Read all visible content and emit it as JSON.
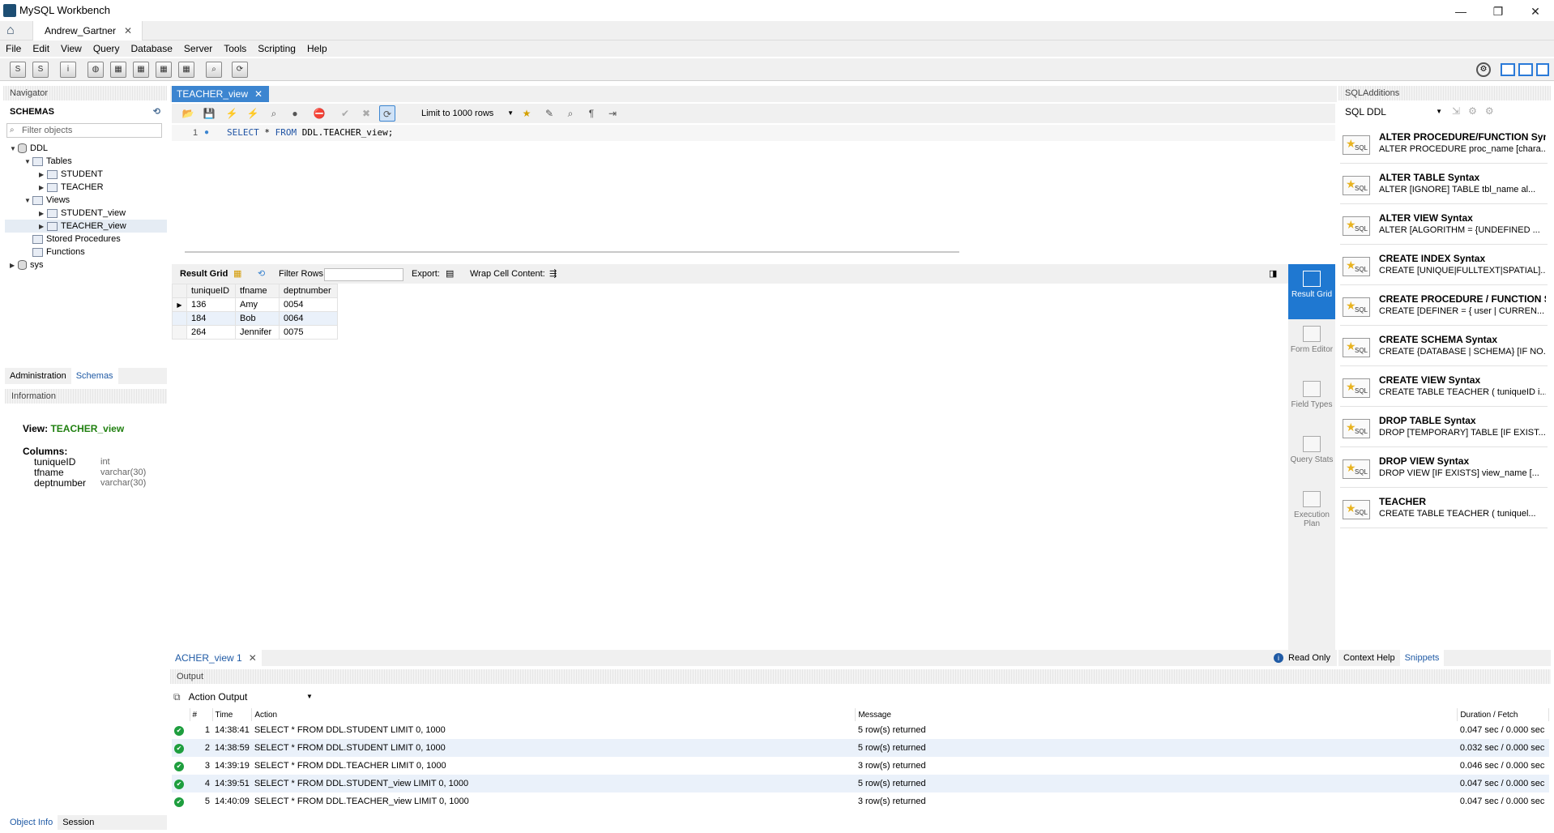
{
  "window": {
    "title": "MySQL Workbench",
    "connection_tab": "Andrew_Gartner"
  },
  "menu": [
    "File",
    "Edit",
    "View",
    "Query",
    "Database",
    "Server",
    "Tools",
    "Scripting",
    "Help"
  ],
  "navigator": {
    "header": "Navigator",
    "schemas_label": "SCHEMAS",
    "filter_placeholder": "Filter objects",
    "tree": {
      "ddl": "DDL",
      "tables": "Tables",
      "student": "STUDENT",
      "teacher": "TEACHER",
      "views": "Views",
      "student_view": "STUDENT_view",
      "teacher_view": "TEACHER_view",
      "procs": "Stored Procedures",
      "funcs": "Functions",
      "sys": "sys"
    },
    "tabs": {
      "admin": "Administration",
      "schemas": "Schemas"
    }
  },
  "information": {
    "header": "Information",
    "view_label": "View:",
    "view_name": "TEACHER_view",
    "columns_label": "Columns:",
    "columns": [
      {
        "name": "tuniqueID",
        "type": "int"
      },
      {
        "name": "tfname",
        "type": "varchar(30)"
      },
      {
        "name": "deptnumber",
        "type": "varchar(30)"
      }
    ],
    "bottom_tabs": {
      "object_info": "Object Info",
      "session": "Session"
    }
  },
  "editor": {
    "tab": "TEACHER_view",
    "limit": "Limit to 1000 rows",
    "line_no": "1",
    "sql": {
      "kw1": "SELECT",
      "star": " * ",
      "kw2": "FROM",
      "rest": " DDL.TEACHER_view;"
    }
  },
  "results": {
    "result_grid_label": "Result Grid",
    "filter_label": "Filter Rows:",
    "export_label": "Export:",
    "wrap_label": "Wrap Cell Content:",
    "columns": [
      "tuniqueID",
      "tfname",
      "deptnumber"
    ],
    "rows": [
      [
        "136",
        "Amy",
        "0054"
      ],
      [
        "184",
        "Bob",
        "0064"
      ],
      [
        "264",
        "Jennifer",
        "0075"
      ]
    ],
    "side_tabs": {
      "result_grid": "Result Grid",
      "form_editor": "Form Editor",
      "field_types": "Field Types",
      "query_stats": "Query Stats",
      "execution_plan": "Execution Plan"
    },
    "result_tab": "ACHER_view 1",
    "read_only": "Read Only"
  },
  "sql_additions": {
    "header": "SQLAdditions",
    "dropdown": "SQL DDL",
    "snippets": [
      {
        "title": "ALTER PROCEDURE/FUNCTION Syn...",
        "sub": "ALTER PROCEDURE proc_name [chara..."
      },
      {
        "title": "ALTER TABLE Syntax",
        "sub": "ALTER [IGNORE] TABLE tbl_name     al..."
      },
      {
        "title": "ALTER VIEW Syntax",
        "sub": "ALTER     [ALGORITHM = {UNDEFINED ..."
      },
      {
        "title": "CREATE INDEX Syntax",
        "sub": "CREATE [UNIQUE|FULLTEXT|SPATIAL]..."
      },
      {
        "title": "CREATE PROCEDURE / FUNCTION S...",
        "sub": "CREATE     [DEFINER = { user | CURREN..."
      },
      {
        "title": "CREATE SCHEMA Syntax",
        "sub": "CREATE {DATABASE | SCHEMA} [IF NO..."
      },
      {
        "title": "CREATE VIEW Syntax",
        "sub": "CREATE TABLE TEACHER ( tuniqueID i..."
      },
      {
        "title": "DROP TABLE Syntax",
        "sub": "DROP [TEMPORARY] TABLE [IF EXIST..."
      },
      {
        "title": "DROP VIEW Syntax",
        "sub": "DROP VIEW [IF EXISTS]     view_name [..."
      },
      {
        "title": "TEACHER",
        "sub": "CREATE TABLE TEACHER (     tuniquel..."
      }
    ],
    "tabs": {
      "context_help": "Context Help",
      "snippets": "Snippets"
    }
  },
  "output": {
    "header": "Output",
    "selector": "Action Output",
    "columns": {
      "num": "#",
      "time": "Time",
      "action": "Action",
      "message": "Message",
      "duration": "Duration / Fetch"
    },
    "rows": [
      {
        "num": "1",
        "time": "14:38:41",
        "action": "SELECT * FROM DDL.STUDENT LIMIT 0, 1000",
        "message": "5 row(s) returned",
        "duration": "0.047 sec / 0.000 sec"
      },
      {
        "num": "2",
        "time": "14:38:59",
        "action": "SELECT * FROM DDL.STUDENT LIMIT 0, 1000",
        "message": "5 row(s) returned",
        "duration": "0.032 sec / 0.000 sec"
      },
      {
        "num": "3",
        "time": "14:39:19",
        "action": "SELECT * FROM DDL.TEACHER LIMIT 0, 1000",
        "message": "3 row(s) returned",
        "duration": "0.046 sec / 0.000 sec"
      },
      {
        "num": "4",
        "time": "14:39:51",
        "action": "SELECT * FROM DDL.STUDENT_view LIMIT 0, 1000",
        "message": "5 row(s) returned",
        "duration": "0.047 sec / 0.000 sec"
      },
      {
        "num": "5",
        "time": "14:40:09",
        "action": "SELECT * FROM DDL.TEACHER_view LIMIT 0, 1000",
        "message": "3 row(s) returned",
        "duration": "0.047 sec / 0.000 sec"
      }
    ]
  },
  "colors": {
    "accent": "#1f78d1",
    "view_name": "#208010",
    "success": "#1e9e3e"
  }
}
